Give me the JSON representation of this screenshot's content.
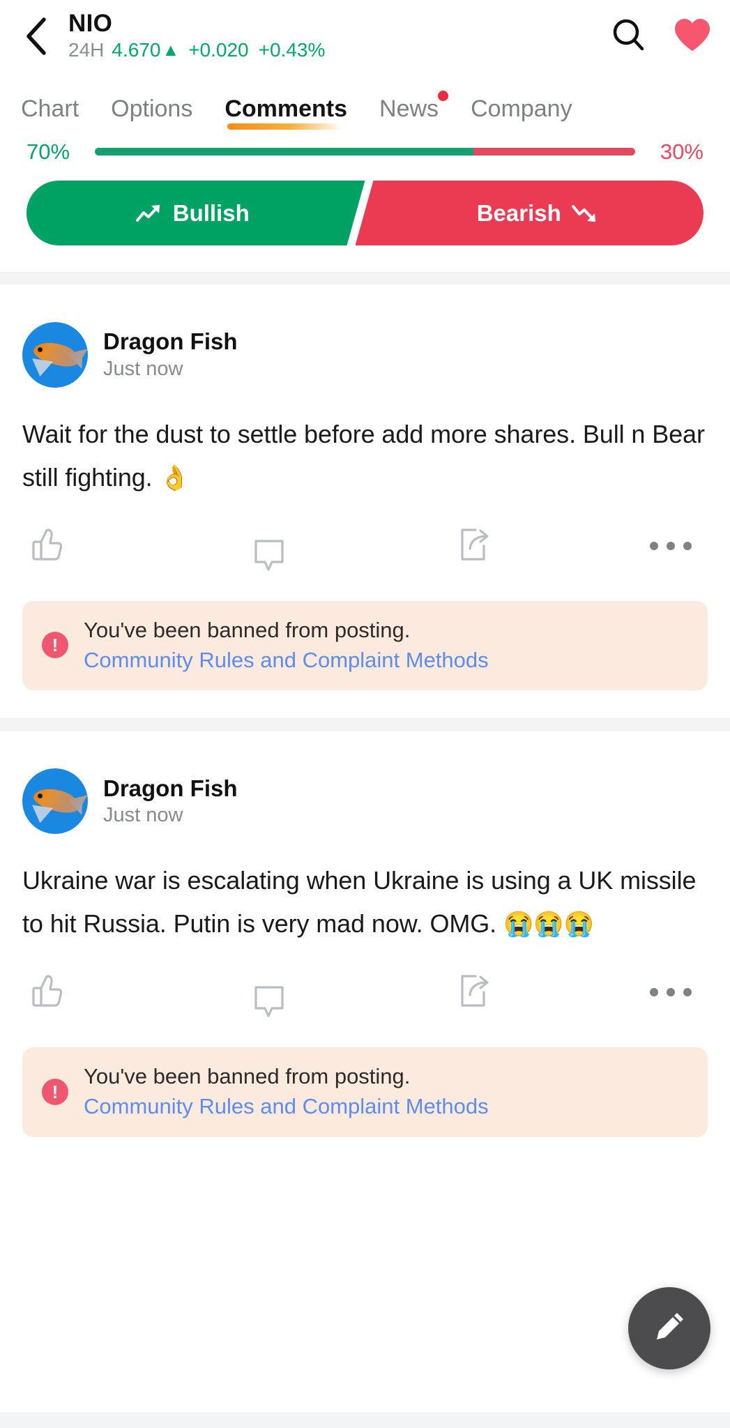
{
  "header": {
    "back_icon": "chevron-left-icon",
    "ticker": "NIO",
    "price_label": "24H",
    "price_value": "4.670",
    "price_arrow": "▲",
    "price_change": "+0.020",
    "price_percent": "+0.43%",
    "search_icon": "search-icon",
    "favorite_icon": "heart-icon",
    "colors": {
      "up": "#00a865",
      "heart": "#f7566f"
    }
  },
  "tabs": [
    {
      "label": "Chart",
      "active": false,
      "badge": false
    },
    {
      "label": "Options",
      "active": false,
      "badge": false
    },
    {
      "label": "Comments",
      "active": true,
      "badge": false
    },
    {
      "label": "News",
      "active": false,
      "badge": true
    },
    {
      "label": "Company",
      "active": false,
      "badge": false
    }
  ],
  "sentiment": {
    "bull_percent_label": "70%",
    "bear_percent_label": "30%",
    "bull_percent": 70,
    "bear_percent": 30,
    "bull_button_label": "Bullish",
    "bear_button_label": "Bearish",
    "bull_icon": "trending-up-icon",
    "bear_icon": "trending-down-icon",
    "colors": {
      "bull": "#00a263",
      "bear": "#eb3b53",
      "bull_track": "#12a06f",
      "bear_track": "#e2485e"
    }
  },
  "comments": [
    {
      "avatar": "dragon-fish-avatar",
      "author": "Dragon Fish",
      "time": "Just now",
      "text": "Wait for the dust to settle before add more shares. Bull n Bear still fighting. ",
      "emoji": "👌",
      "actions": {
        "like_icon": "thumbs-up-icon",
        "comment_icon": "comment-bubble-icon",
        "share_icon": "share-icon",
        "more_icon": "more-horizontal-icon"
      },
      "notice": {
        "icon": "warning-icon",
        "message": "You've been banned from posting.",
        "link": "Community Rules and Complaint Methods"
      }
    },
    {
      "avatar": "dragon-fish-avatar",
      "author": "Dragon Fish",
      "time": "Just now",
      "text": "Ukraine war is escalating when Ukraine is using a UK missile to hit Russia. Putin is very mad now. OMG. ",
      "emoji": "😭😭😭",
      "actions": {
        "like_icon": "thumbs-up-icon",
        "comment_icon": "comment-bubble-icon",
        "share_icon": "share-icon",
        "more_icon": "more-horizontal-icon"
      },
      "notice": {
        "icon": "warning-icon",
        "message": "You've been banned from posting.",
        "link": "Community Rules and Complaint Methods"
      }
    }
  ],
  "fab": {
    "icon": "pencil-icon",
    "color": "#4c4c4e"
  }
}
